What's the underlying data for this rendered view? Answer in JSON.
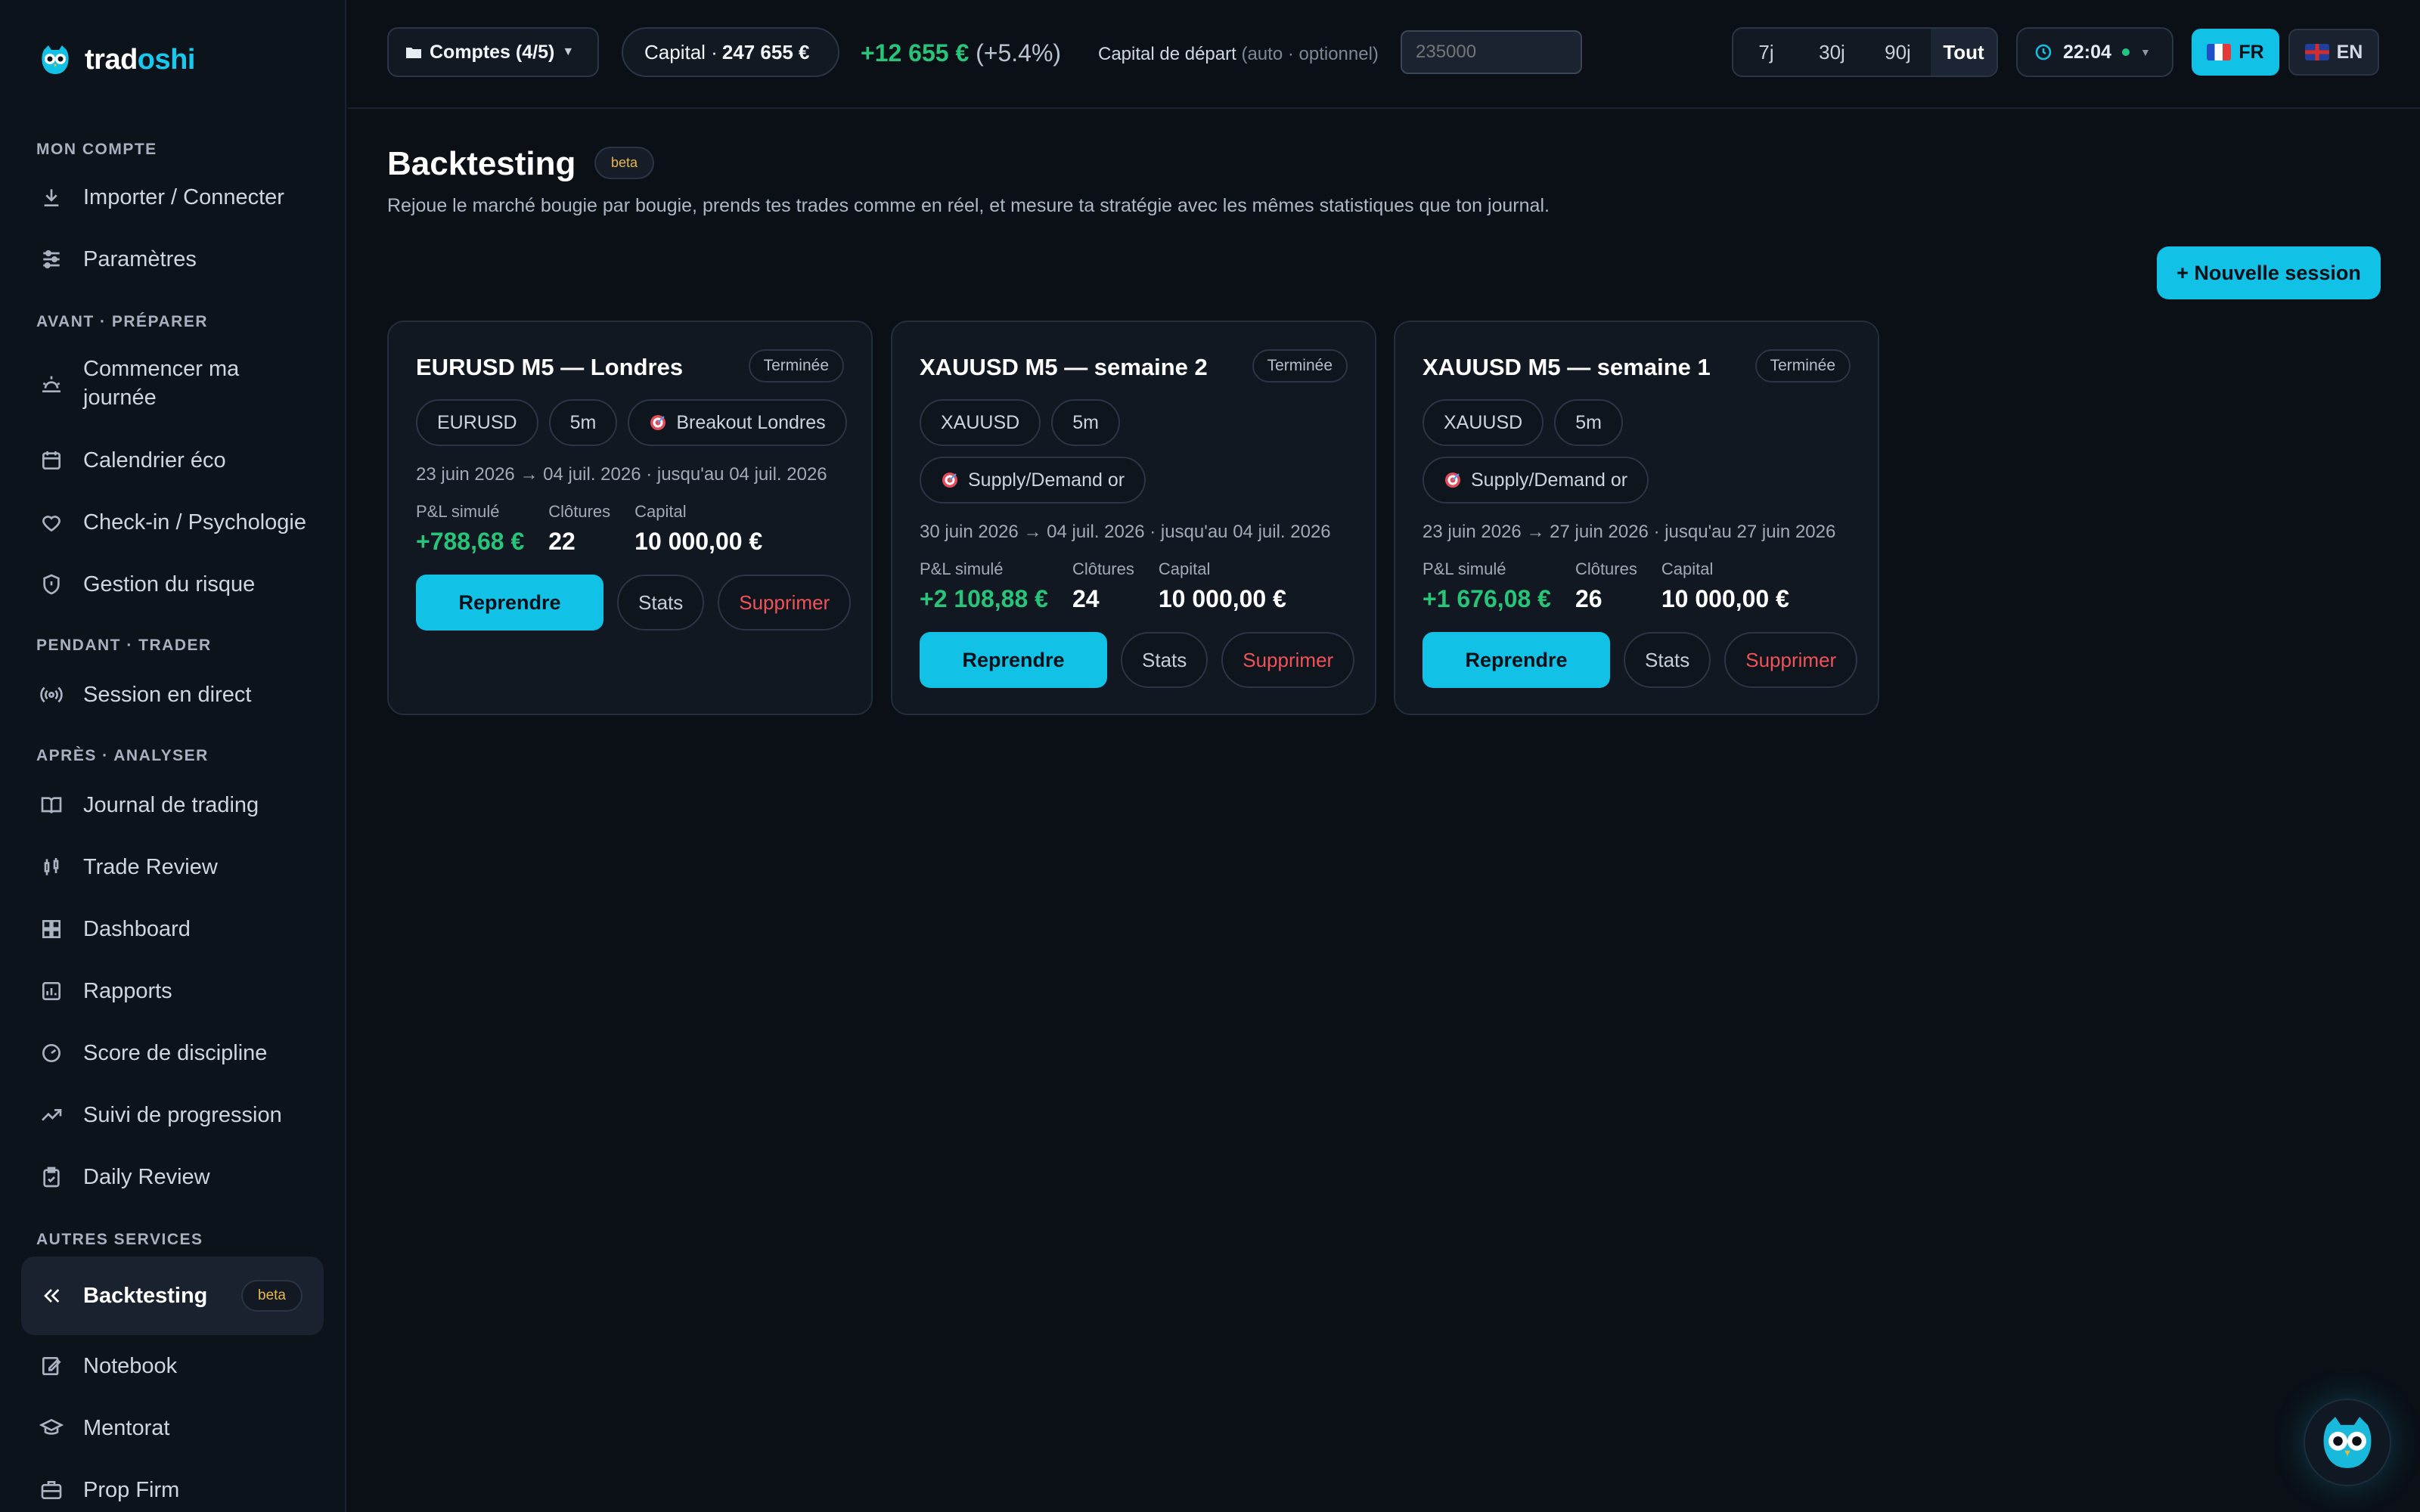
{
  "brand": {
    "name_part1": "trad",
    "name_part2": "oshi"
  },
  "sidebar": {
    "sections": [
      {
        "label": "MON COMPTE"
      },
      {
        "label": "AVANT · PRÉPARER"
      },
      {
        "label": "PENDANT · TRADER"
      },
      {
        "label": "APRÈS · ANALYSER"
      },
      {
        "label": "AUTRES SERVICES"
      }
    ],
    "items": [
      {
        "label": "Importer / Connecter",
        "icon": "download-icon"
      },
      {
        "label": "Paramètres",
        "icon": "sliders-icon"
      },
      {
        "label": "Commencer ma journée",
        "icon": "sunrise-icon"
      },
      {
        "label": "Calendrier éco",
        "icon": "calendar-icon"
      },
      {
        "label": "Check-in / Psychologie",
        "icon": "heart-icon"
      },
      {
        "label": "Gestion du risque",
        "icon": "shield-icon"
      },
      {
        "label": "Session en direct",
        "icon": "broadcast-icon"
      },
      {
        "label": "Journal de trading",
        "icon": "book-icon"
      },
      {
        "label": "Trade Review",
        "icon": "candles-icon"
      },
      {
        "label": "Dashboard",
        "icon": "grid-icon"
      },
      {
        "label": "Rapports",
        "icon": "report-icon"
      },
      {
        "label": "Score de discipline",
        "icon": "gauge-icon"
      },
      {
        "label": "Suivi de progression",
        "icon": "trend-icon"
      },
      {
        "label": "Daily Review",
        "icon": "clipboard-icon"
      },
      {
        "label": "Backtesting",
        "icon": "rewind-icon",
        "badge": "beta",
        "active": true
      },
      {
        "label": "Notebook",
        "icon": "notebook-icon"
      },
      {
        "label": "Mentorat",
        "icon": "graduation-icon"
      },
      {
        "label": "Prop Firm",
        "icon": "briefcase-icon"
      }
    ]
  },
  "topbar": {
    "accounts_label": "Comptes (4/5)",
    "capital_label": "Capital ·",
    "capital_value": "247 655 €",
    "pnl_value": "+12 655 €",
    "pnl_pct": "(+5.4%)",
    "start_capital_label": "Capital de départ",
    "start_capital_hint": "(auto · optionnel)",
    "start_capital_placeholder": "235000",
    "ranges": [
      "7j",
      "30j",
      "90j",
      "Tout"
    ],
    "active_range": "Tout",
    "clock": "22:04",
    "lang_fr": "FR",
    "lang_en": "EN"
  },
  "page": {
    "title": "Backtesting",
    "badge": "beta",
    "subtitle": "Rejoue le marché bougie par bougie, prends tes trades comme en réel, et mesure ta stratégie avec les mêmes statistiques que ton journal.",
    "new_session": "+ Nouvelle session"
  },
  "sessions": [
    {
      "title": "EURUSD M5 — Londres",
      "status": "Terminée",
      "tags": [
        "EURUSD",
        "5m"
      ],
      "strategy": "Breakout Londres",
      "dates": "23 juin 2026 → 04 juil. 2026 · jusqu'au 04 juil. 2026",
      "pnl_label": "P&L simulé",
      "pnl": "+788,68 €",
      "closes_label": "Clôtures",
      "closes": "22",
      "capital_label": "Capital",
      "capital": "10 000,00 €",
      "resume": "Reprendre",
      "stats": "Stats",
      "delete": "Supprimer"
    },
    {
      "title": "XAUUSD M5 — semaine 2",
      "status": "Terminée",
      "tags": [
        "XAUUSD",
        "5m"
      ],
      "strategy": "Supply/Demand or",
      "dates": "30 juin 2026 → 04 juil. 2026 · jusqu'au 04 juil. 2026",
      "pnl_label": "P&L simulé",
      "pnl": "+2 108,88 €",
      "closes_label": "Clôtures",
      "closes": "24",
      "capital_label": "Capital",
      "capital": "10 000,00 €",
      "resume": "Reprendre",
      "stats": "Stats",
      "delete": "Supprimer"
    },
    {
      "title": "XAUUSD M5 — semaine 1",
      "status": "Terminée",
      "tags": [
        "XAUUSD",
        "5m"
      ],
      "strategy": "Supply/Demand or",
      "dates": "23 juin 2026 → 27 juin 2026 · jusqu'au 27 juin 2026",
      "pnl_label": "P&L simulé",
      "pnl": "+1 676,08 €",
      "closes_label": "Clôtures",
      "closes": "26",
      "capital_label": "Capital",
      "capital": "10 000,00 €",
      "resume": "Reprendre",
      "stats": "Stats",
      "delete": "Supprimer"
    }
  ],
  "colors": {
    "accent": "#12c1e6",
    "positive": "#27c47a",
    "danger": "#f0525a",
    "beta": "#e6b84c",
    "bg": "#0b1017"
  }
}
